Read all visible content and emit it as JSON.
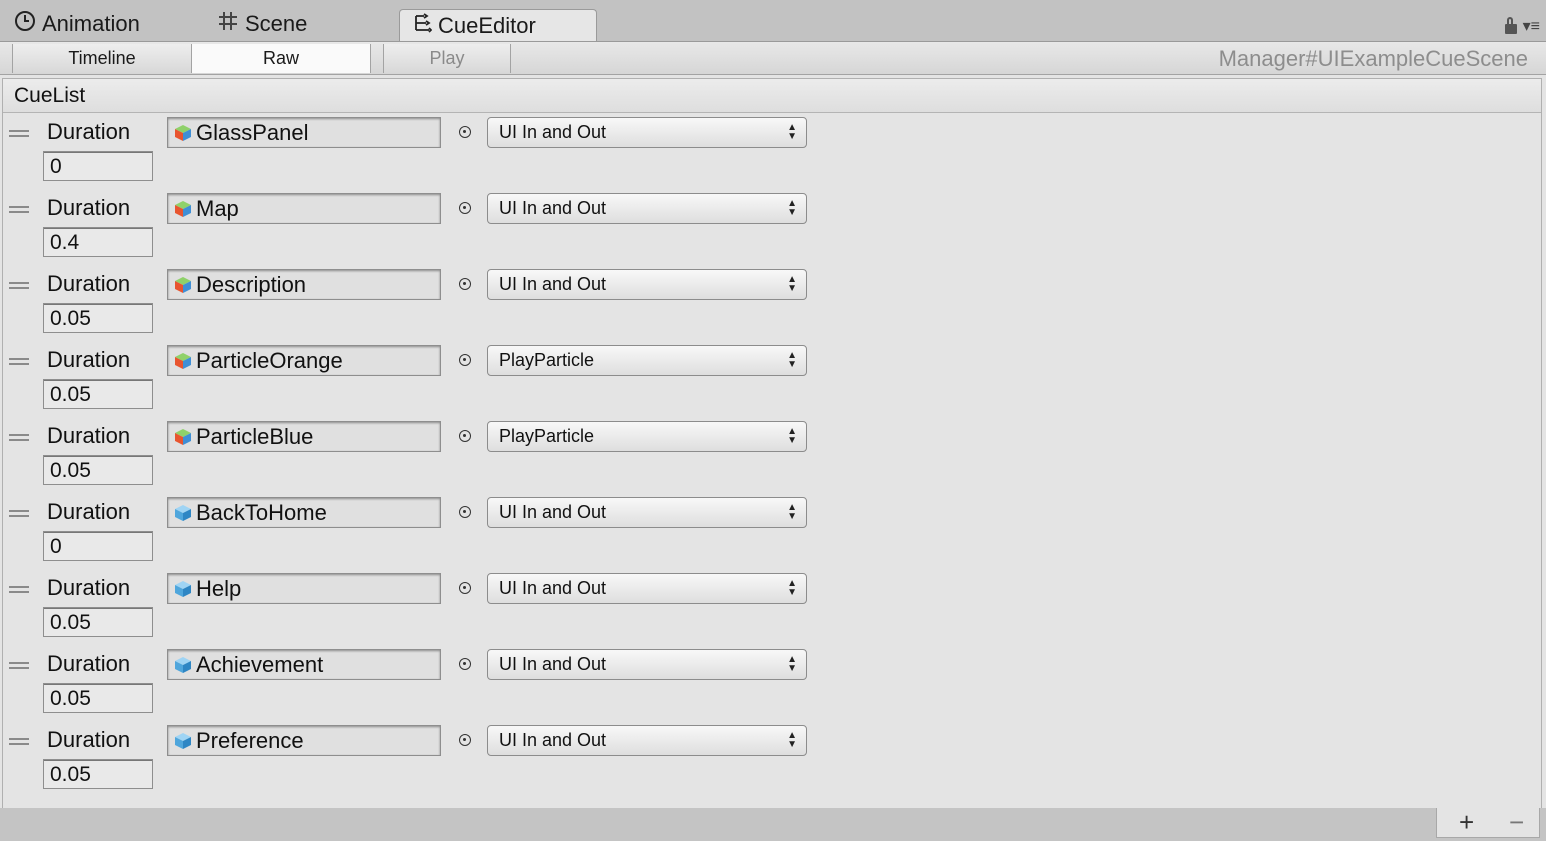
{
  "window_tabs": [
    {
      "label": "Animation",
      "icon": "clock-icon"
    },
    {
      "label": "Scene",
      "icon": "grid-icon"
    },
    {
      "label": "CueEditor",
      "icon": "cue-editor-icon",
      "active": true
    }
  ],
  "toolbar": {
    "timeline_label": "Timeline",
    "raw_label": "Raw",
    "play_label": "Play",
    "scene_name": "Manager#UIExampleCueScene"
  },
  "cuelist": {
    "header": "CueList",
    "duration_label": "Duration",
    "items": [
      {
        "duration": "0",
        "object": "GlassPanel",
        "action": "UI In and Out",
        "icon": "colored-cube-icon"
      },
      {
        "duration": "0.4",
        "object": "Map",
        "action": "UI In and Out",
        "icon": "colored-cube-icon"
      },
      {
        "duration": "0.05",
        "object": "Description",
        "action": "UI In and Out",
        "icon": "colored-cube-icon"
      },
      {
        "duration": "0.05",
        "object": "ParticleOrange",
        "action": "PlayParticle",
        "icon": "colored-cube-icon"
      },
      {
        "duration": "0.05",
        "object": "ParticleBlue",
        "action": "PlayParticle",
        "icon": "colored-cube-icon"
      },
      {
        "duration": "0",
        "object": "BackToHome",
        "action": "UI In and Out",
        "icon": "blue-cube-icon"
      },
      {
        "duration": "0.05",
        "object": "Help",
        "action": "UI In and Out",
        "icon": "blue-cube-icon"
      },
      {
        "duration": "0.05",
        "object": "Achievement",
        "action": "UI In and Out",
        "icon": "blue-cube-icon"
      },
      {
        "duration": "0.05",
        "object": "Preference",
        "action": "UI In and Out",
        "icon": "blue-cube-icon"
      }
    ]
  },
  "footer": {
    "add_label": "+",
    "remove_label": "−"
  }
}
